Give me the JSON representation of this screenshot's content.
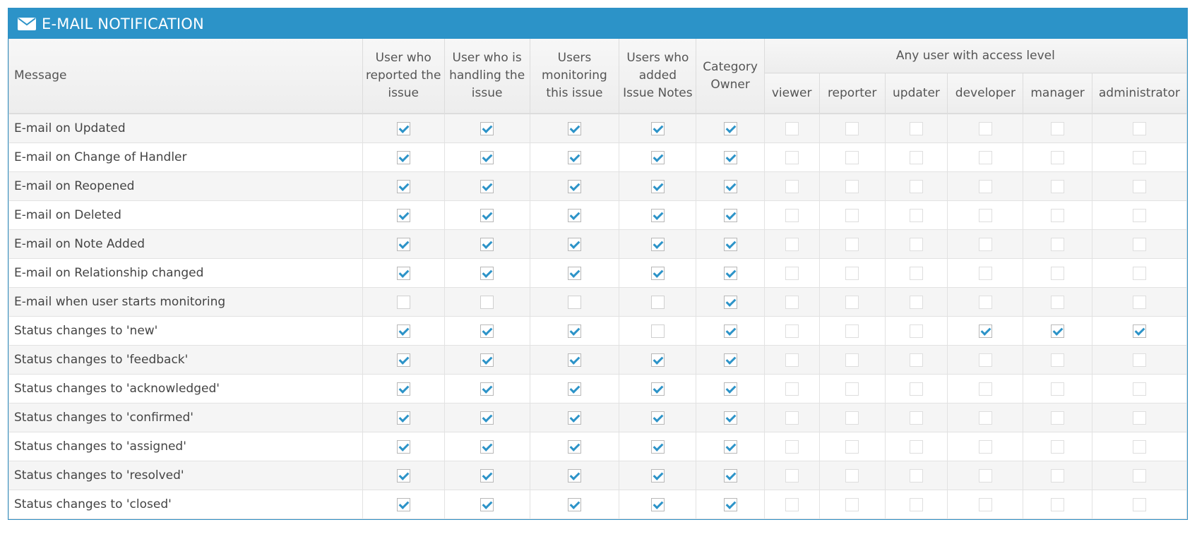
{
  "header": {
    "title": "E-MAIL NOTIFICATION",
    "icon": "envelope-icon"
  },
  "colors": {
    "header_bg": "#2c93c8",
    "check": "#2c93c8"
  },
  "columns": {
    "message": "Message",
    "reporter": "User who reported the issue",
    "handler": "User who is handling the issue",
    "monitor": "Users monitoring this issue",
    "notes": "Users who added Issue Notes",
    "category": "Category Owner",
    "access_group": "Any user with access level",
    "access_levels": [
      "viewer",
      "reporter",
      "updater",
      "developer",
      "manager",
      "administrator"
    ]
  },
  "rows": [
    {
      "label": "E-mail on Updated",
      "checks": [
        1,
        1,
        1,
        1,
        1,
        0,
        0,
        0,
        0,
        0,
        0
      ]
    },
    {
      "label": "E-mail on Change of Handler",
      "checks": [
        1,
        1,
        1,
        1,
        1,
        0,
        0,
        0,
        0,
        0,
        0
      ]
    },
    {
      "label": "E-mail on Reopened",
      "checks": [
        1,
        1,
        1,
        1,
        1,
        0,
        0,
        0,
        0,
        0,
        0
      ]
    },
    {
      "label": "E-mail on Deleted",
      "checks": [
        1,
        1,
        1,
        1,
        1,
        0,
        0,
        0,
        0,
        0,
        0
      ]
    },
    {
      "label": "E-mail on Note Added",
      "checks": [
        1,
        1,
        1,
        1,
        1,
        0,
        0,
        0,
        0,
        0,
        0
      ]
    },
    {
      "label": "E-mail on Relationship changed",
      "checks": [
        1,
        1,
        1,
        1,
        1,
        0,
        0,
        0,
        0,
        0,
        0
      ]
    },
    {
      "label": "E-mail when user starts monitoring",
      "checks": [
        0,
        0,
        0,
        0,
        1,
        0,
        0,
        0,
        0,
        0,
        0
      ]
    },
    {
      "label": "Status changes to 'new'",
      "checks": [
        1,
        1,
        1,
        0,
        1,
        0,
        0,
        0,
        1,
        1,
        1
      ]
    },
    {
      "label": "Status changes to 'feedback'",
      "checks": [
        1,
        1,
        1,
        1,
        1,
        0,
        0,
        0,
        0,
        0,
        0
      ]
    },
    {
      "label": "Status changes to 'acknowledged'",
      "checks": [
        1,
        1,
        1,
        1,
        1,
        0,
        0,
        0,
        0,
        0,
        0
      ]
    },
    {
      "label": "Status changes to 'confirmed'",
      "checks": [
        1,
        1,
        1,
        1,
        1,
        0,
        0,
        0,
        0,
        0,
        0
      ]
    },
    {
      "label": "Status changes to 'assigned'",
      "checks": [
        1,
        1,
        1,
        1,
        1,
        0,
        0,
        0,
        0,
        0,
        0
      ]
    },
    {
      "label": "Status changes to 'resolved'",
      "checks": [
        1,
        1,
        1,
        1,
        1,
        0,
        0,
        0,
        0,
        0,
        0
      ]
    },
    {
      "label": "Status changes to 'closed'",
      "checks": [
        1,
        1,
        1,
        1,
        1,
        0,
        0,
        0,
        0,
        0,
        0
      ]
    }
  ]
}
